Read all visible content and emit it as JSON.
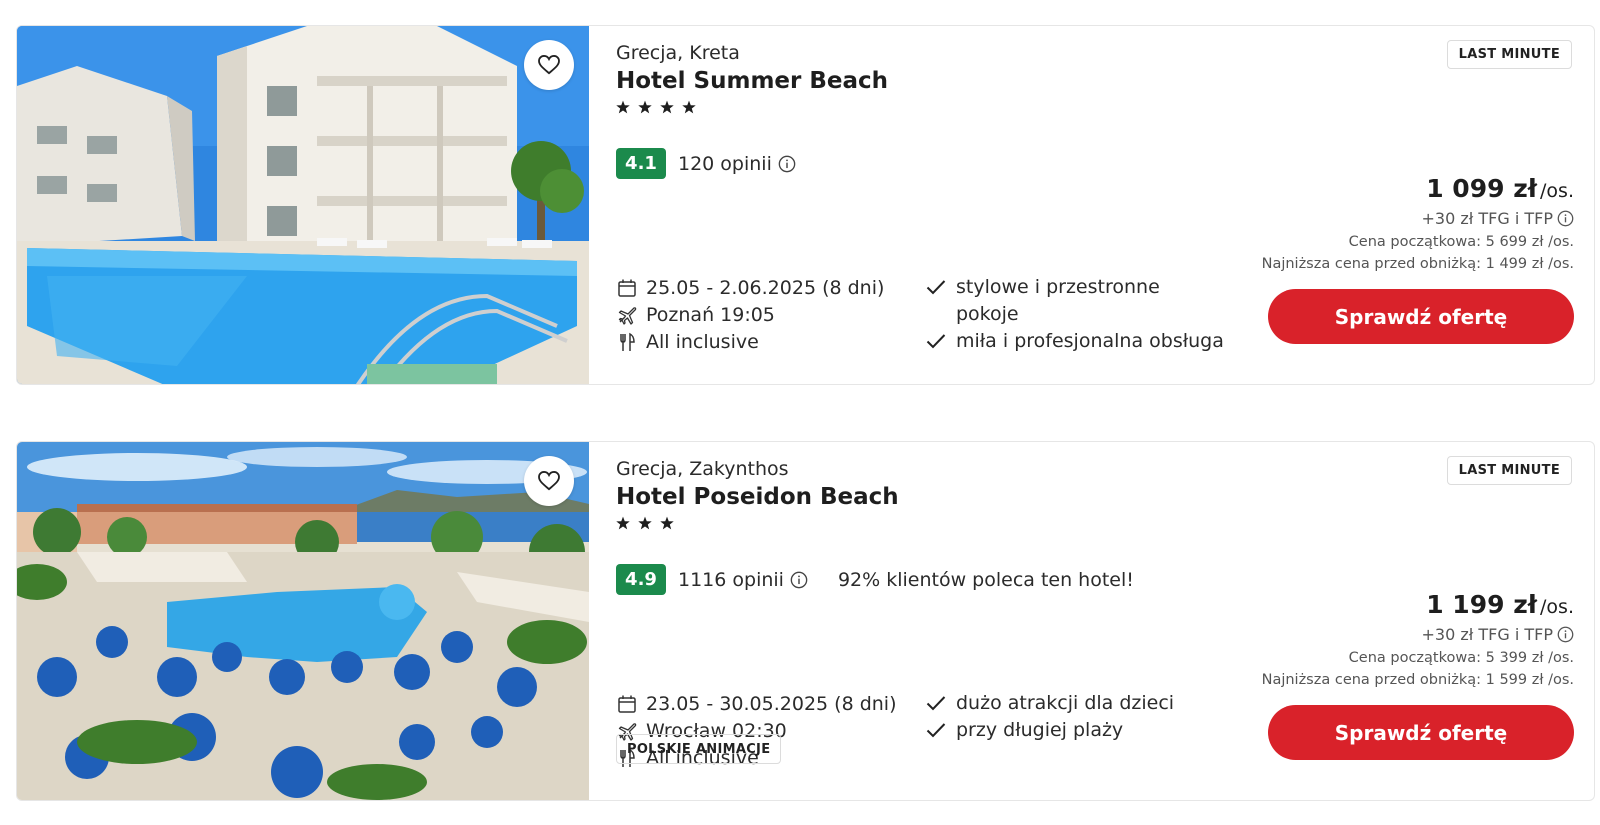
{
  "offers": [
    {
      "location": "Grecja, Kreta",
      "hotel_name": "Hotel Summer Beach",
      "stars": 4,
      "score": "4.1",
      "reviews": "120 opinii",
      "recommend": "",
      "badge": "LAST MINUTE",
      "dates": "25.05 - 2.06.2025 (8 dni)",
      "departure": "Poznań 19:05",
      "board": "All inclusive",
      "features": [
        "stylowe i przestronne pokoje",
        "miła i profesjonalna obsługa"
      ],
      "extra_tag": "",
      "price": "1 099 zł",
      "price_unit": "/os.",
      "tfg": "+30 zł TFG i TFP",
      "initial_price": "Cena początkowa: 5 699 zł /os.",
      "lowest_price": "Najniższa cena przed obniżką: 1 499 zł /os.",
      "cta": "Sprawdź ofertę"
    },
    {
      "location": "Grecja, Zakynthos",
      "hotel_name": "Hotel Poseidon Beach",
      "stars": 3,
      "score": "4.9",
      "reviews": "1116 opinii",
      "recommend": "92% klientów poleca ten hotel!",
      "badge": "LAST MINUTE",
      "dates": "23.05 - 30.05.2025 (8 dni)",
      "departure": "Wrocław 02:30",
      "board": "All inclusive",
      "features": [
        "dużo atrakcji dla dzieci",
        "przy długiej plaży"
      ],
      "extra_tag": "POLSKIE ANIMACJE",
      "price": "1 199 zł",
      "price_unit": "/os.",
      "tfg": "+30 zł TFG i TFP",
      "initial_price": "Cena początkowa: 5 399 zł /os.",
      "lowest_price": "Najniższa cena przed obniżką: 1 599 zł /os.",
      "cta": "Sprawdź ofertę"
    }
  ],
  "colors": {
    "score_bg": "#1b8a4c",
    "cta_bg": "#d9222a",
    "pool": "#2ea3ee",
    "sky": "#2f86e0"
  },
  "icons": [
    "heart-icon",
    "star-icon",
    "info-icon",
    "calendar-icon",
    "plane-icon",
    "cutlery-icon",
    "check-icon"
  ]
}
